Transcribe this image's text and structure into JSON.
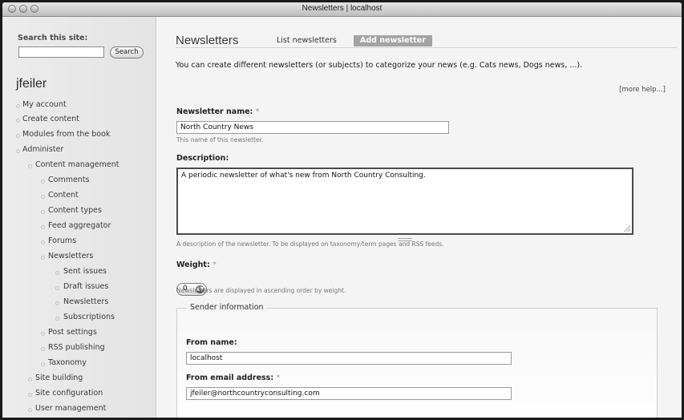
{
  "window": {
    "title": "Newsletters | localhost"
  },
  "sidebar": {
    "search_label": "Search this site:",
    "search_value": "",
    "search_button": "Search",
    "username": "jfeiler",
    "items": [
      {
        "label": "My account"
      },
      {
        "label": "Create content"
      },
      {
        "label": "Modules from the book"
      },
      {
        "label": "Administer"
      },
      {
        "label": "Content management"
      },
      {
        "label": "Comments"
      },
      {
        "label": "Content"
      },
      {
        "label": "Content types"
      },
      {
        "label": "Feed aggregator"
      },
      {
        "label": "Forums"
      },
      {
        "label": "Newsletters"
      },
      {
        "label": "Sent issues"
      },
      {
        "label": "Draft issues"
      },
      {
        "label": "Newsletters"
      },
      {
        "label": "Subscriptions"
      },
      {
        "label": "Post settings"
      },
      {
        "label": "RSS publishing"
      },
      {
        "label": "Taxonomy"
      },
      {
        "label": "Site building"
      },
      {
        "label": "Site configuration"
      },
      {
        "label": "User management"
      }
    ]
  },
  "main": {
    "page_title": "Newsletters",
    "tabs": [
      {
        "label": "List newsletters",
        "active": false
      },
      {
        "label": "Add newsletter",
        "active": true
      }
    ],
    "intro": "You can create different newsletters (or subjects) to categorize your news (e.g. Cats news, Dogs news, ...).",
    "more_help": "[more help...]",
    "fields": {
      "name": {
        "label": "Newsletter name:",
        "required_mark": "*",
        "value": "North Country News",
        "description": "This name of this newsletter."
      },
      "description": {
        "label": "Description:",
        "value": "A periodic newsletter of what's new from North Country Consulting.",
        "description": "A description of the newsletter. To be displayed on taxonomy/term pages and RSS feeds."
      },
      "weight": {
        "label": "Weight:",
        "required_mark": "*",
        "value": "0",
        "description": "Newsletters are displayed in ascending order by weight."
      }
    },
    "sender": {
      "legend": "Sender information",
      "from_name_label": "From name:",
      "from_name_value": "localhost",
      "from_email_label": "From email address:",
      "from_email_required_mark": "*",
      "from_email_value": "jfeiler@northcountryconsulting.com"
    }
  },
  "colors": {
    "active_tab_bg": "#a3a3a3",
    "sidebar_bg": "#e8e8e8",
    "page_bg": "#f4f4f4"
  }
}
